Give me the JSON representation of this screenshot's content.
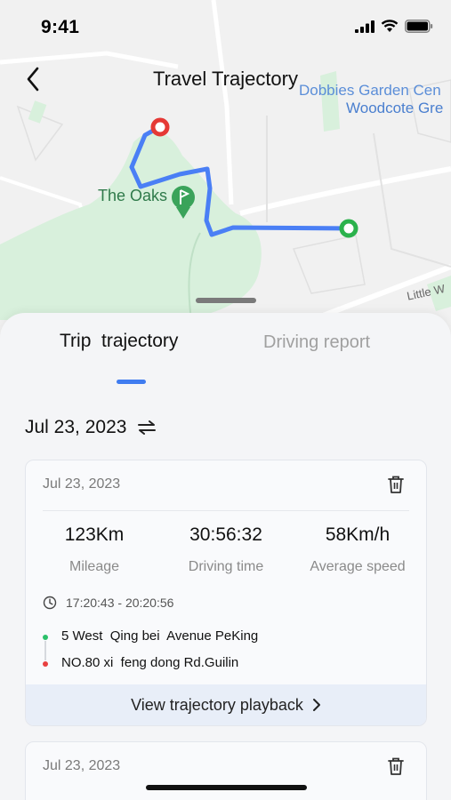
{
  "status_bar": {
    "time": "9:41"
  },
  "header": {
    "title": "Travel Trajectory"
  },
  "map": {
    "labels": {
      "dobbies": "Dobbies Garden Cen",
      "woodcote": "Woodcote Gre",
      "oaks": "The Oaks",
      "little": "Little W"
    },
    "colors": {
      "route": "#4a7ff5",
      "start_marker": "#e53935",
      "end_marker": "#2bb24c",
      "park": "#d8f0dc"
    }
  },
  "tabs": [
    {
      "label": "Trip  trajectory",
      "active": true
    },
    {
      "label": "Driving report",
      "active": false
    }
  ],
  "date_filter": {
    "label": "Jul 23, 2023"
  },
  "trips": [
    {
      "date": "Jul 23, 2023",
      "stats": [
        {
          "value": "123Km",
          "label": "Mileage"
        },
        {
          "value": "30:56:32",
          "label": "Driving time"
        },
        {
          "value": "58Km/h",
          "label": "Average speed"
        }
      ],
      "time_range": "17:20:43 - 20:20:56",
      "start_address": "5 West  Qing bei  Avenue PeKing",
      "end_address": "NO.80 xi  feng dong Rd.Guilin",
      "action_label": "View trajectory playback"
    },
    {
      "date": "Jul 23, 2023"
    }
  ],
  "accent_color": "#3f7cf0"
}
